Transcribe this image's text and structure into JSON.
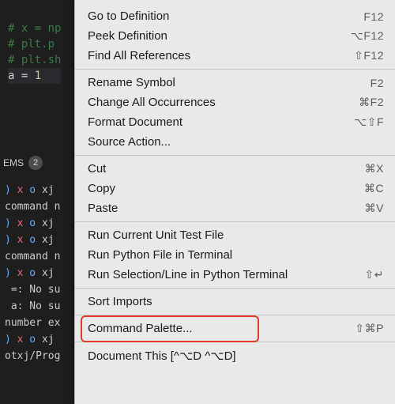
{
  "editor": {
    "lines": {
      "l1": "# x = np",
      "l2": "# plt.p",
      "l3": "# plt.sh",
      "blank1": "",
      "blank2": "",
      "assign_var": "a",
      "assign_eq": " = ",
      "assign_val": "1"
    }
  },
  "panel": {
    "tab": "EMS",
    "count": "2"
  },
  "terminal": {
    "t1a": ") ",
    "t1b": "x",
    "t1c": " o ",
    "t1d": "xj",
    "t2": "command n",
    "t3a": ") ",
    "t3b": "x",
    "t3c": " o ",
    "t3d": "xj",
    "t4a": ") ",
    "t4b": "x",
    "t4c": " o ",
    "t4d": "xj",
    "t5": "command n",
    "t6a": ") ",
    "t6b": "x",
    "t6c": " o ",
    "t6d": "xj",
    "t7": " =: No su",
    "t8": " a: No su",
    "t9": "number ex",
    "t10a": ") ",
    "t10b": "x",
    "t10c": " o ",
    "t10d": "xj",
    "t11": "otxj/Prog"
  },
  "menu": {
    "items": [
      {
        "label": "Go to Definition",
        "shortcut": "F12"
      },
      {
        "label": "Peek Definition",
        "shortcut": "⌥F12"
      },
      {
        "label": "Find All References",
        "shortcut": "⇧F12"
      }
    ],
    "group2": [
      {
        "label": "Rename Symbol",
        "shortcut": "F2"
      },
      {
        "label": "Change All Occurrences",
        "shortcut": "⌘F2"
      },
      {
        "label": "Format Document",
        "shortcut": "⌥⇧F"
      },
      {
        "label": "Source Action...",
        "shortcut": ""
      }
    ],
    "group3": [
      {
        "label": "Cut",
        "shortcut": "⌘X"
      },
      {
        "label": "Copy",
        "shortcut": "⌘C"
      },
      {
        "label": "Paste",
        "shortcut": "⌘V"
      }
    ],
    "group4": [
      {
        "label": "Run Current Unit Test File",
        "shortcut": ""
      },
      {
        "label": "Run Python File in Terminal",
        "shortcut": ""
      },
      {
        "label": "Run Selection/Line in Python Terminal",
        "shortcut": "⇧↵"
      }
    ],
    "group5": [
      {
        "label": "Sort Imports",
        "shortcut": ""
      }
    ],
    "group6": [
      {
        "label": "Command Palette...",
        "shortcut": "⇧⌘P"
      }
    ],
    "group7": [
      {
        "label": "Document This [^⌥D ^⌥D]",
        "shortcut": ""
      }
    ]
  },
  "highlight": {
    "target": "Sort Imports"
  }
}
